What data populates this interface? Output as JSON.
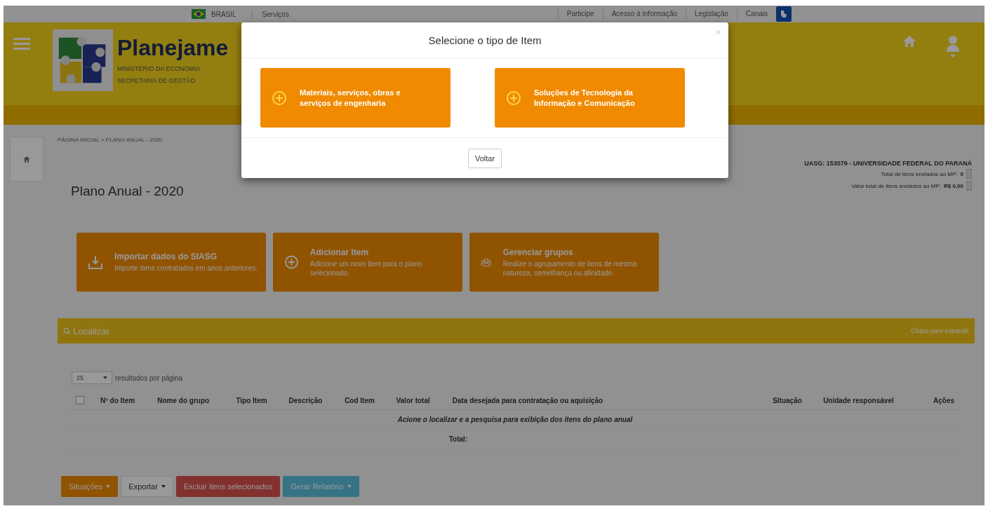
{
  "gov_bar": {
    "country": "BRASIL",
    "left_links": [
      "Serviços"
    ],
    "right_links": [
      "Participe",
      "Acesso à informação",
      "Legislação",
      "Canais"
    ]
  },
  "header": {
    "title": "Planejame",
    "subtitle_lines": [
      "MINISTÉRIO DA ECONOMIA",
      "SECRETARIA DE GESTÃO"
    ]
  },
  "breadcrumb": "PÁGINA INICIAL > PLANO ANUAL - 2020",
  "page_title": "Plano Anual - 2020",
  "uasg": {
    "unit": "UASG: 153079 - UNIVERSIDADE FEDERAL DO PARANÁ",
    "lines": [
      {
        "label": "Total de itens enviados ao MP:",
        "value": "0"
      },
      {
        "label": "Valor total de itens enviados ao MP:",
        "value": "R$ 0,00"
      }
    ]
  },
  "action_cards": [
    {
      "kind": "import",
      "title": "Importar dados do SIASG",
      "description": "Importe itens contratados em anos anteriores."
    },
    {
      "kind": "add",
      "title": "Adicionar Item",
      "description": "Adicione um novo item para o plano selecionado."
    },
    {
      "kind": "groups",
      "title": "Gerenciar grupos",
      "description": "Realize o agrupamento de itens de mesma natureza, semelhança ou afinidade."
    }
  ],
  "search_panel": {
    "title": "Localizar",
    "toggle": "Clique para expandir"
  },
  "page_size": {
    "value": "25",
    "label": "resultados por página"
  },
  "table": {
    "select_all": {
      "checked": false
    },
    "columns": [
      "Nº do Item",
      "Nome do grupo",
      "Tipo Item",
      "Descrição",
      "Cod Item",
      "Valor total",
      "Data desejada para contratação ou aquisição",
      "Situação",
      "Unidade responsável",
      "Ações"
    ],
    "empty_message": "Acione o localizar e a pesquisa para exibição dos itens do plano anual",
    "total_label": "Total:"
  },
  "buttons": [
    {
      "label": "Situações",
      "kind": "warning",
      "dropdown": true
    },
    {
      "label": "Exportar",
      "kind": "default",
      "dropdown": true
    },
    {
      "label": "Excluir itens selecionados",
      "kind": "danger",
      "dropdown": false
    },
    {
      "label": "Gerar Relatório",
      "kind": "info",
      "dropdown": true
    }
  ],
  "modal": {
    "title": "Selecione o tipo de Item",
    "close": "×",
    "options": [
      "Materiais, serviços, obras e serviços de engenharia",
      "Soluções de Tecnologia da Informação e Comunicação"
    ],
    "back_button": "Voltar"
  }
}
